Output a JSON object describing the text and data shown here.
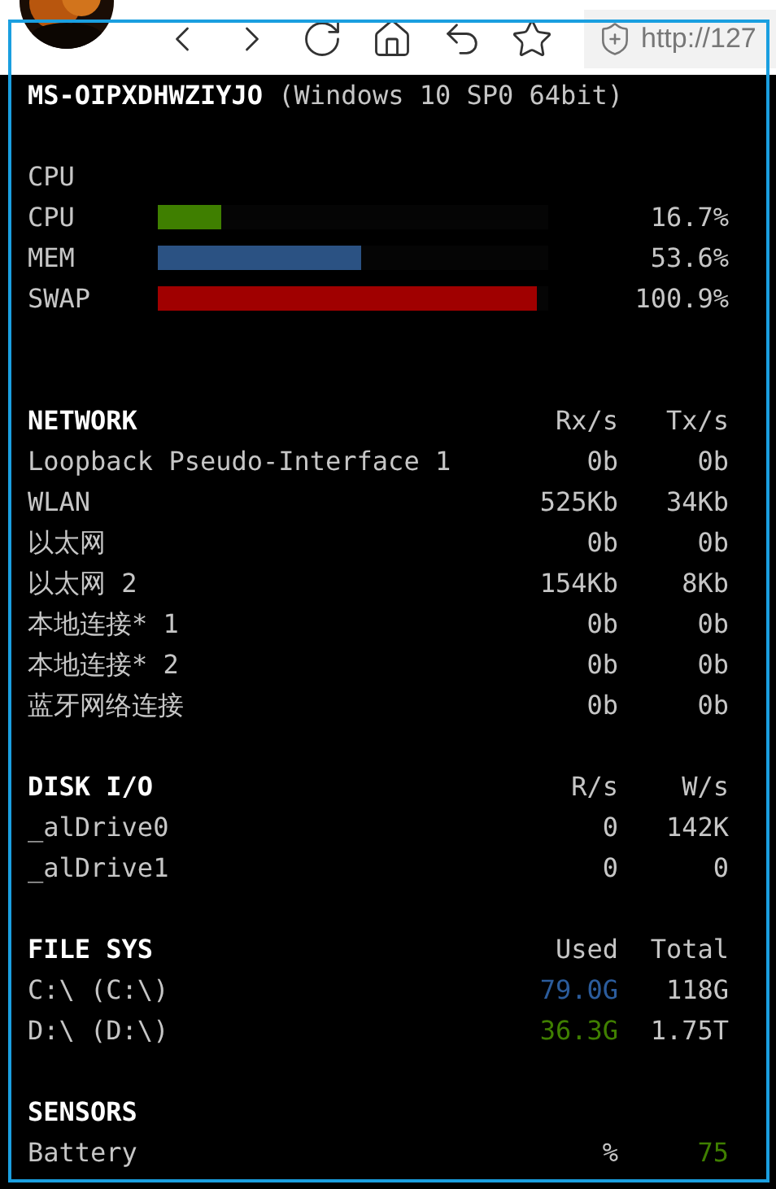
{
  "browser": {
    "address": "http://127"
  },
  "host": {
    "name": "MS-OIPXDHWZIYJO",
    "os": "(Windows 10 SP0 64bit)"
  },
  "cpu": {
    "title": "CPU",
    "meters": [
      {
        "label": "CPU",
        "level": 0.167,
        "reading": "16.7%",
        "color": "#3f7f00"
      },
      {
        "label": "MEM",
        "level": 0.536,
        "reading": "53.6%",
        "color": "#2b5283"
      },
      {
        "label": "SWAP",
        "level": 1.0,
        "reading": "100.9%",
        "color": "#a00000"
      }
    ]
  },
  "sections": [
    {
      "title": "NETWORK",
      "columns": [
        "Rx/s",
        "Tx/s"
      ],
      "rows": [
        {
          "name": "Loopback Pseudo-Interface 1",
          "cells": [
            {
              "text": "0b"
            },
            {
              "text": "0b"
            }
          ]
        },
        {
          "name": "WLAN",
          "cells": [
            {
              "text": "525Kb"
            },
            {
              "text": "34Kb"
            }
          ]
        },
        {
          "name": "以太网",
          "cells": [
            {
              "text": "0b"
            },
            {
              "text": "0b"
            }
          ]
        },
        {
          "name": "以太网 2",
          "cells": [
            {
              "text": "154Kb"
            },
            {
              "text": "8Kb"
            }
          ]
        },
        {
          "name": "本地连接* 1",
          "cells": [
            {
              "text": "0b"
            },
            {
              "text": "0b"
            }
          ]
        },
        {
          "name": "本地连接* 2",
          "cells": [
            {
              "text": "0b"
            },
            {
              "text": "0b"
            }
          ]
        },
        {
          "name": "蓝牙网络连接",
          "cells": [
            {
              "text": "0b"
            },
            {
              "text": "0b"
            }
          ]
        }
      ]
    },
    {
      "title": "DISK I/O",
      "columns": [
        "R/s",
        "W/s"
      ],
      "rows": [
        {
          "name": "_alDrive0",
          "cells": [
            {
              "text": "0"
            },
            {
              "text": "142K"
            }
          ]
        },
        {
          "name": "_alDrive1",
          "cells": [
            {
              "text": "0"
            },
            {
              "text": "0"
            }
          ]
        }
      ]
    },
    {
      "title": "FILE SYS",
      "columns": [
        "Used",
        "Total"
      ],
      "rows": [
        {
          "name": "C:\\ (C:\\)",
          "cells": [
            {
              "text": "79.0G",
              "color": "#2b5c9c"
            },
            {
              "text": "118G"
            }
          ]
        },
        {
          "name": "D:\\ (D:\\)",
          "cells": [
            {
              "text": "36.3G",
              "color": "#3f7f00"
            },
            {
              "text": "1.75T"
            }
          ]
        }
      ]
    },
    {
      "title": "SENSORS",
      "rows": [
        {
          "name": "Battery",
          "cells": [
            {
              "text": "%"
            },
            {
              "text": "75",
              "color": "#3f7f00"
            }
          ]
        }
      ]
    }
  ]
}
